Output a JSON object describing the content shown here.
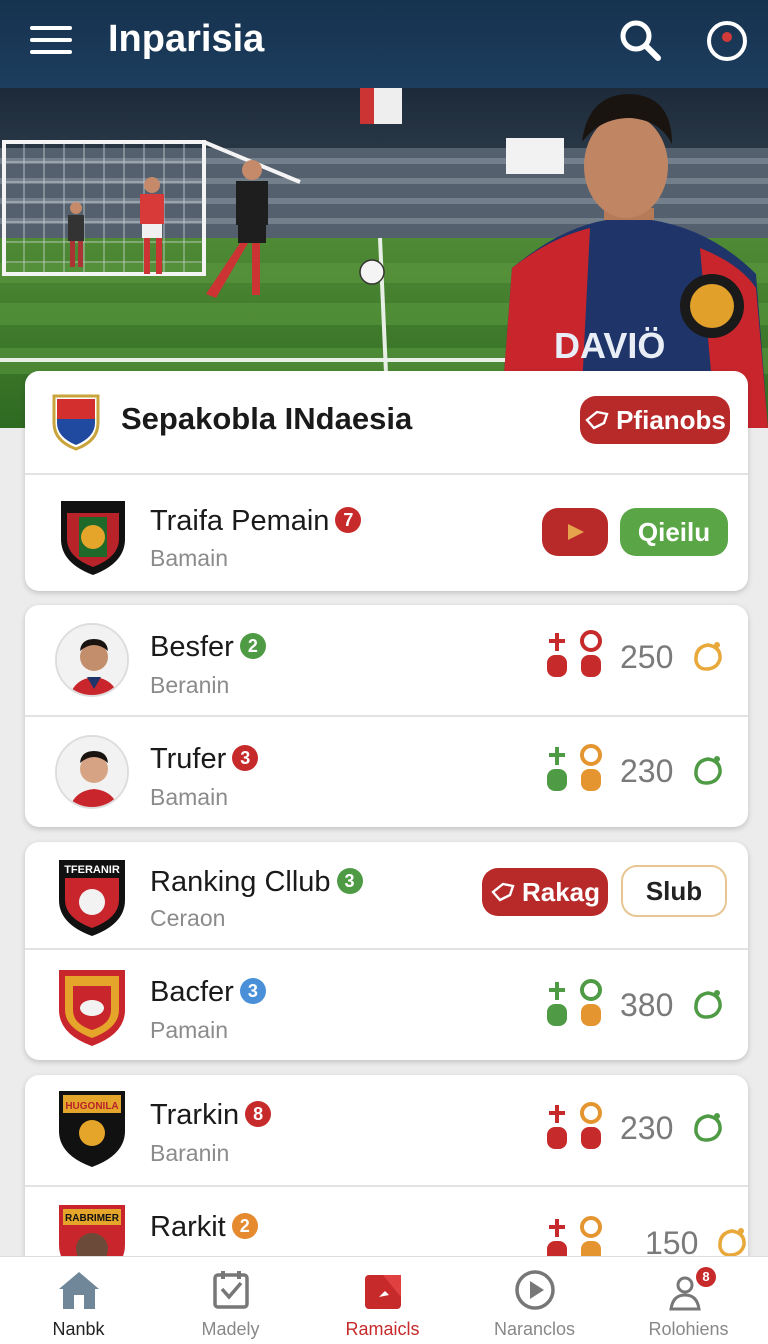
{
  "header": {
    "title": "Inparisia"
  },
  "hero": {
    "jersey_text": "DAVIÖ"
  },
  "league_card": {
    "title": "Sepakobla INdaesia",
    "action_label": "Pfianobs",
    "row": {
      "title": "Traifa Pemain",
      "badge": "7",
      "subtitle": "Bamain",
      "button_label": "Qieilu"
    }
  },
  "players_card": {
    "rows": [
      {
        "name": "Besfer",
        "badge": "2",
        "subtitle": "Beranin",
        "score": "250"
      },
      {
        "name": "Trufer",
        "badge": "3",
        "subtitle": "Bamain",
        "score": "230"
      }
    ]
  },
  "ranking_card": {
    "title": "Ranking Cllub",
    "badge": "3",
    "subtitle": "Ceraon",
    "primary_label": "Rakag",
    "secondary_label": "Slub",
    "crest_text": "TFERANIR",
    "row": {
      "name": "Bacfer",
      "badge": "3",
      "subtitle": "Pamain",
      "score": "380"
    }
  },
  "bottom_card": {
    "rows": [
      {
        "name": "Trarkin",
        "badge": "8",
        "subtitle": "Baranin",
        "score": "230",
        "crest_text": "HUGONILA"
      },
      {
        "name": "Rarkit",
        "badge": "2",
        "subtitle": "",
        "score": "150",
        "crest_text": "RABRIMER"
      }
    ]
  },
  "bottom_nav": {
    "items": [
      {
        "label": "Nanbk"
      },
      {
        "label": "Madely"
      },
      {
        "label": "Ramaicls"
      },
      {
        "label": "Naranclos"
      },
      {
        "label": "Rolohiens"
      }
    ],
    "notification_badge": "8"
  },
  "colors": {
    "header": "#1b3a5a",
    "accent_red": "#b82a2a",
    "accent_green": "#5aa646",
    "badge_blue": "#4a90d9",
    "badge_orange": "#e58a2e"
  }
}
